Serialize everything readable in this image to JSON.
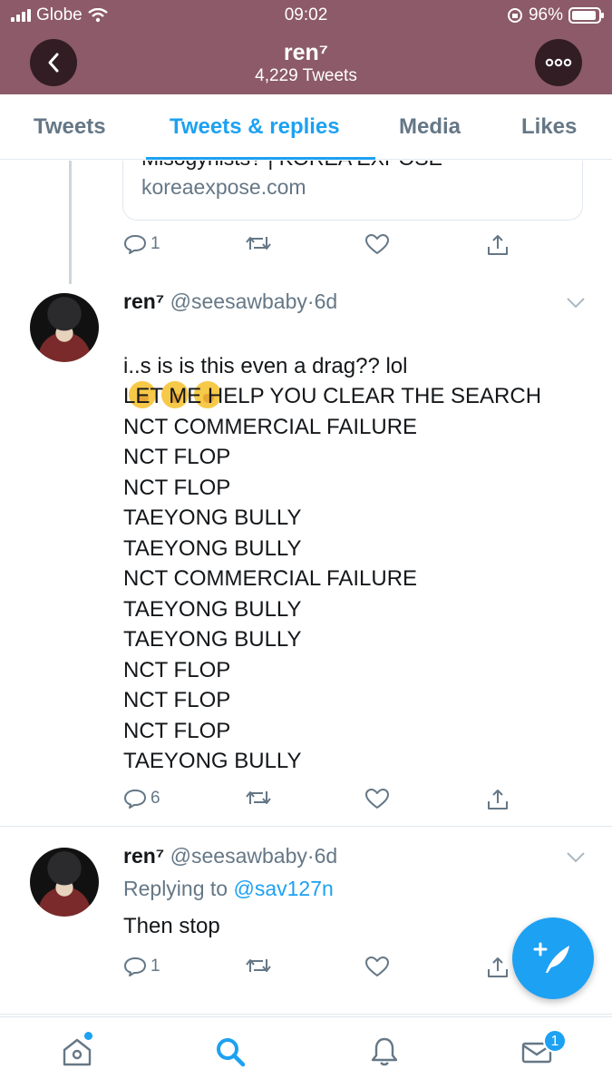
{
  "status_bar": {
    "carrier": "Globe",
    "time": "09:02",
    "battery": "96%"
  },
  "header": {
    "name": "ren⁷",
    "tweet_count": "4,229 Tweets"
  },
  "tabs": [
    {
      "label": "Tweets"
    },
    {
      "label": "Tweets & replies"
    },
    {
      "label": "Media"
    },
    {
      "label": "Likes"
    }
  ],
  "link_card": {
    "title": "Misogynists? | KOREA EXPOSE",
    "domain": "koreaexpose.com"
  },
  "tweet0": {
    "reply_count": "1"
  },
  "tweets": [
    {
      "name": "ren⁷",
      "handle": "@seesawbaby",
      "dot": "·",
      "time": "6d",
      "first_line": "i..s is is this even a drag?? lol",
      "body": "LET ME HELP YOU CLEAR THE SEARCH\nNCT COMMERCIAL FAILURE\nNCT FLOP\nNCT FLOP\nTAEYONG BULLY\nTAEYONG BULLY\nNCT COMMERCIAL FAILURE\nTAEYONG BULLY\nTAEYONG BULLY\nNCT FLOP\nNCT FLOP\nNCT FLOP\nTAEYONG BULLY",
      "reply_count": "6"
    },
    {
      "name": "ren⁷",
      "handle": "@seesawbaby",
      "dot": "·",
      "time": "6d",
      "replying_prefix": "Replying to",
      "replying_handle": "@sav127n",
      "text": "Then stop",
      "reply_count": "1"
    }
  ],
  "bottom_nav": {
    "messages_badge": "1"
  },
  "colors": {
    "accent": "#1da1f2",
    "header_bg": "#8c5a68",
    "secondary_text": "#657786"
  }
}
